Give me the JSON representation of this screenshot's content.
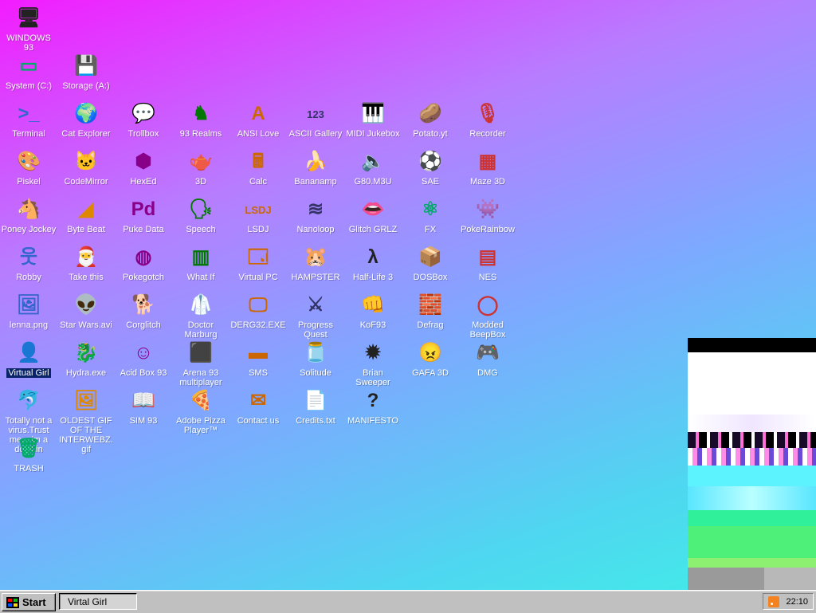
{
  "desktop": {
    "icons": [
      {
        "label": "WINDOWS 93",
        "symbol": "computer-icon",
        "glyph": "🖥"
      },
      {
        "label": "System (C:)",
        "symbol": "harddrive-icon",
        "glyph": "▭"
      },
      {
        "label": "Storage (A:)",
        "symbol": "floppy-drive-icon",
        "glyph": "💾"
      },
      {
        "label": "Terminal",
        "symbol": "terminal-icon",
        "glyph": ">_"
      },
      {
        "label": "Cat Explorer",
        "symbol": "globe-icon",
        "glyph": "🌍"
      },
      {
        "label": "Trollbox",
        "symbol": "chat-icon",
        "glyph": "💬"
      },
      {
        "label": "93 Realms",
        "symbol": "knight-icon",
        "glyph": "♞"
      },
      {
        "label": "ANSI Love",
        "symbol": "letter-a-icon",
        "glyph": "A"
      },
      {
        "label": "ASCII Gallery",
        "symbol": "numbers-icon",
        "glyph": "123"
      },
      {
        "label": "MIDI Jukebox",
        "symbol": "piano-icon",
        "glyph": "🎹"
      },
      {
        "label": "Potato.yt",
        "symbol": "potato-icon",
        "glyph": "🥔"
      },
      {
        "label": "Recorder",
        "symbol": "microphone-icon",
        "glyph": "🎙"
      },
      {
        "label": "Piskel",
        "symbol": "palette-icon",
        "glyph": "🎨"
      },
      {
        "label": "CodeMirror",
        "symbol": "cat-icon",
        "glyph": "🐱"
      },
      {
        "label": "HexEd",
        "symbol": "cube-icon",
        "glyph": "⬢"
      },
      {
        "label": "3D",
        "symbol": "teapot-icon",
        "glyph": "🫖"
      },
      {
        "label": "Calc",
        "symbol": "calculator-icon",
        "glyph": "🖩"
      },
      {
        "label": "Bananamp",
        "symbol": "banana-icon",
        "glyph": "🍌"
      },
      {
        "label": "G80.M3U",
        "symbol": "speaker-file-icon",
        "glyph": "🔈"
      },
      {
        "label": "SAE",
        "symbol": "ball-icon",
        "glyph": "⚽"
      },
      {
        "label": "Maze 3D",
        "symbol": "maze-icon",
        "glyph": "▦"
      },
      {
        "label": "Poney Jockey",
        "symbol": "pony-icon",
        "glyph": "🐴"
      },
      {
        "label": "Byte Beat",
        "symbol": "wave-icon",
        "glyph": "◢"
      },
      {
        "label": "Puke Data",
        "symbol": "pd-icon",
        "glyph": "Pd"
      },
      {
        "label": "Speech",
        "symbol": "face-icon",
        "glyph": "🗣"
      },
      {
        "label": "LSDJ",
        "symbol": "gameboy-icon",
        "glyph": "LSDJ"
      },
      {
        "label": "Nanoloop",
        "symbol": "stripes-icon",
        "glyph": "≋"
      },
      {
        "label": "Glitch GRLZ",
        "symbol": "lips-icon",
        "glyph": "👄"
      },
      {
        "label": "FX",
        "symbol": "atom-icon",
        "glyph": "⚛"
      },
      {
        "label": "PokeRainbow",
        "symbol": "pixel-people-icon",
        "glyph": "👾"
      },
      {
        "label": "Robby",
        "symbol": "stickman-icon",
        "glyph": "웃"
      },
      {
        "label": "Take this",
        "symbol": "santa-icon",
        "glyph": "🎅"
      },
      {
        "label": "Pokegotch",
        "symbol": "pokeball-icon",
        "glyph": "◍"
      },
      {
        "label": "What If",
        "symbol": "waveform-icon",
        "glyph": "▥"
      },
      {
        "label": "Virtual PC",
        "symbol": "window-icon",
        "glyph": "🗔"
      },
      {
        "label": "HAMPSTER",
        "symbol": "hamster-icon",
        "glyph": "🐹"
      },
      {
        "label": "Half-Life 3",
        "symbol": "lambda-icon",
        "glyph": "λ"
      },
      {
        "label": "DOSBox",
        "symbol": "box-icon",
        "glyph": "📦"
      },
      {
        "label": "NES",
        "symbol": "nes-icon",
        "glyph": "▤"
      },
      {
        "label": "lenna.png",
        "symbol": "image-file-icon",
        "glyph": "🖼"
      },
      {
        "label": "Star Wars.avi",
        "symbol": "yoda-icon",
        "glyph": "👽"
      },
      {
        "label": "Corglitch",
        "symbol": "dog-icon",
        "glyph": "🐕"
      },
      {
        "label": "Doctor Marburg",
        "symbol": "doctor-icon",
        "glyph": "🥼"
      },
      {
        "label": "DERG32.EXE",
        "symbol": "monitor-face-icon",
        "glyph": "🖵"
      },
      {
        "label": "Progress Quest",
        "symbol": "swords-icon",
        "glyph": "⚔"
      },
      {
        "label": "KoF93",
        "symbol": "fighter-icon",
        "glyph": "👊"
      },
      {
        "label": "Defrag",
        "symbol": "defrag-icon",
        "glyph": "🧱"
      },
      {
        "label": "Modded BeepBox",
        "symbol": "ring-icon",
        "glyph": "◯"
      },
      {
        "label": "Virtual Girl",
        "symbol": "blue-face-icon",
        "glyph": "👤"
      },
      {
        "label": "Hydra.exe",
        "symbol": "dragon-icon",
        "glyph": "🐉"
      },
      {
        "label": "Acid Box 93",
        "symbol": "smiley-icon",
        "glyph": "☺"
      },
      {
        "label": "Arena 93 multiplayer",
        "symbol": "colored-cube-icon",
        "glyph": "⬛"
      },
      {
        "label": "SMS",
        "symbol": "console-icon",
        "glyph": "▬"
      },
      {
        "label": "Solitude",
        "symbol": "jar-icon",
        "glyph": "🫙"
      },
      {
        "label": "Brian Sweeper",
        "symbol": "mine-icon",
        "glyph": "✹"
      },
      {
        "label": "GAFA 3D",
        "symbol": "doom-face-icon",
        "glyph": "😠"
      },
      {
        "label": "DMG",
        "symbol": "gamepad-icon",
        "glyph": "🎮"
      },
      {
        "label": "Totally not a virus.Trust me... im a dolphin",
        "symbol": "dolphin-icon",
        "glyph": "🐬"
      },
      {
        "label": "OLDEST GIF OF THE INTERWEBZ.gif",
        "symbol": "gif-file-icon",
        "glyph": "🖼"
      },
      {
        "label": "SIM 93",
        "symbol": "book-icon",
        "glyph": "📖"
      },
      {
        "label": "Adobe Pizza Player™",
        "symbol": "pizza-icon",
        "glyph": "🍕"
      },
      {
        "label": "Contact us",
        "symbol": "mail-icon",
        "glyph": "✉"
      },
      {
        "label": "Credits.txt",
        "symbol": "text-file-icon",
        "glyph": "📄"
      },
      {
        "label": "MANIFESTO",
        "symbol": "question-icon",
        "glyph": "?"
      },
      {
        "label": "TRASH",
        "symbol": "trash-icon",
        "glyph": "🗑"
      }
    ],
    "selected_label": "Virtual Girl"
  },
  "taskbar": {
    "start_label": "Start",
    "task_label": "Virtal Girl",
    "clock": "22:10",
    "tray_icon": "rss-icon"
  },
  "colors": {
    "bg_top_left": "#f31cff",
    "bg_bottom_right": "#3ef2e6",
    "taskbar": "#c0c0c0",
    "selection": "#0a246a"
  }
}
